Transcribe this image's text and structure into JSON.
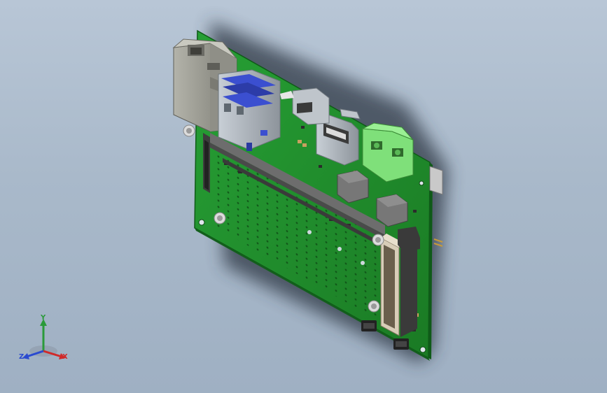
{
  "triad": {
    "x_label": "X",
    "y_label": "Y",
    "z_label": "Z",
    "x_color": "#d02a2a",
    "y_color": "#2a9a3a",
    "z_color": "#2a4ad0"
  },
  "colors": {
    "background_top": "#b8c6d6",
    "background_bottom": "#9fb0c3",
    "pcb_green": "#1f8a2a",
    "rj45_gray": "#9a9a92",
    "usb_blue": "#3b4fd0",
    "terminal_green": "#7fe07a",
    "shadow": "#3a4452"
  }
}
